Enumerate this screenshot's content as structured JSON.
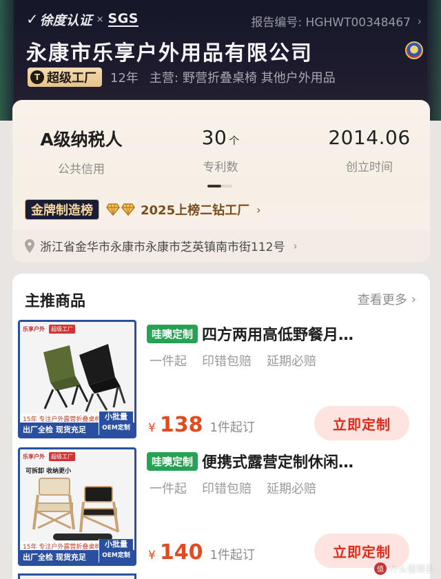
{
  "header": {
    "cert_label": "徐度认证",
    "cert_x": "×",
    "sgs": "SGS",
    "report_label": "报告编号: HGHWT00348467",
    "company_name": "永康市乐享户外用品有限公司",
    "super_factory": "超级工厂",
    "years": "12年",
    "main_biz_label": "主营:",
    "main_biz": "野营折叠桌椅 其他户外用品"
  },
  "stats": [
    {
      "value": "A级纳税人",
      "unit": "",
      "label": "公共信用"
    },
    {
      "value": "30",
      "unit": "个",
      "label": "专利数"
    },
    {
      "value": "2014.06",
      "unit": "",
      "label": "创立时间"
    }
  ],
  "gold": {
    "badge": "金牌制造榜",
    "text": "2025上榜二钻工厂"
  },
  "address": "浙江省金华市永康市永康市芝英镇南市街112号",
  "products_section": {
    "title": "主推商品",
    "see_more": "查看更多"
  },
  "products": [
    {
      "tag": "哇噢定制",
      "name": "四方两用高低野餐月…",
      "tags": [
        "一件起",
        "印错包赔",
        "延期必赔"
      ],
      "yen": "¥",
      "price": "138",
      "moq": "1件起订",
      "button": "立即定制",
      "thumb_brand": "乐享户外",
      "thumb_factory": "超级工厂",
      "thumb_sub": "",
      "thumb_band": "15年 专注户外露营折叠桌椅",
      "thumb_bottom": "出厂全检 现货充足",
      "thumb_batch": "小批量",
      "thumb_oem": "OEM定制"
    },
    {
      "tag": "哇噢定制",
      "name": "便携式露营定制休闲…",
      "tags": [
        "一件起",
        "印错包赔",
        "延期必赔"
      ],
      "yen": "¥",
      "price": "140",
      "moq": "1件起订",
      "button": "立即定制",
      "thumb_brand": "乐享户外",
      "thumb_factory": "超级工厂",
      "thumb_sub": "可拆卸 收纳更小",
      "thumb_band": "15年 专注户外露营折叠桌椅",
      "thumb_bottom": "出厂全检 现货充足",
      "thumb_batch": "小批量",
      "thumb_oem": "OEM定制"
    }
  ],
  "watermark": {
    "badge": "值",
    "text": "什么值得买"
  },
  "colors": {
    "accent_red": "#de2a18",
    "price_orange": "#e34a1d",
    "tag_green": "#27a153",
    "header_navy": "#191d33",
    "thumb_blue": "#2a4fa0"
  }
}
